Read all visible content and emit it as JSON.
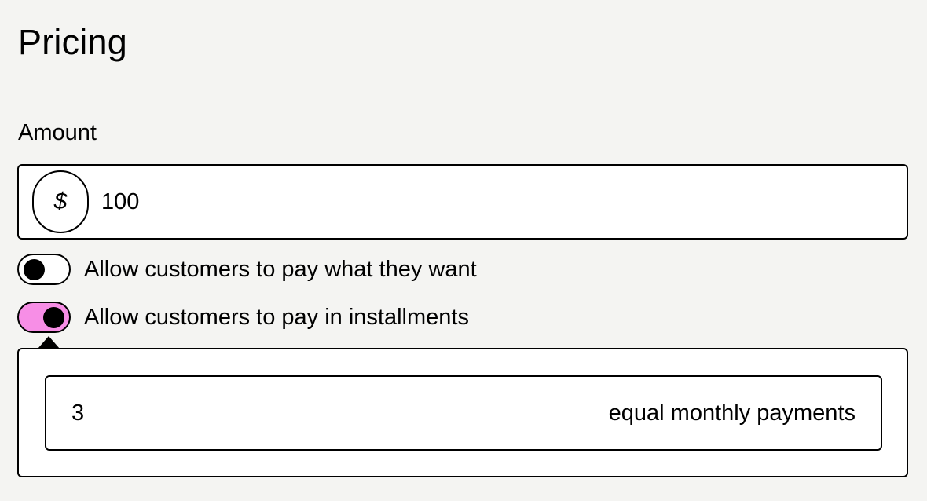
{
  "section": {
    "title": "Pricing"
  },
  "amount": {
    "label": "Amount",
    "currency_symbol": "$",
    "value": "100"
  },
  "options": {
    "pay_what_they_want": {
      "label": "Allow customers to pay what they want",
      "enabled": false
    },
    "installments": {
      "label": "Allow customers to pay in installments",
      "enabled": true
    }
  },
  "installments": {
    "count": "3",
    "suffix": "equal monthly payments"
  },
  "colors": {
    "background": "#f4f4f2",
    "toggle_on": "#f78ee6",
    "border": "#000000"
  }
}
